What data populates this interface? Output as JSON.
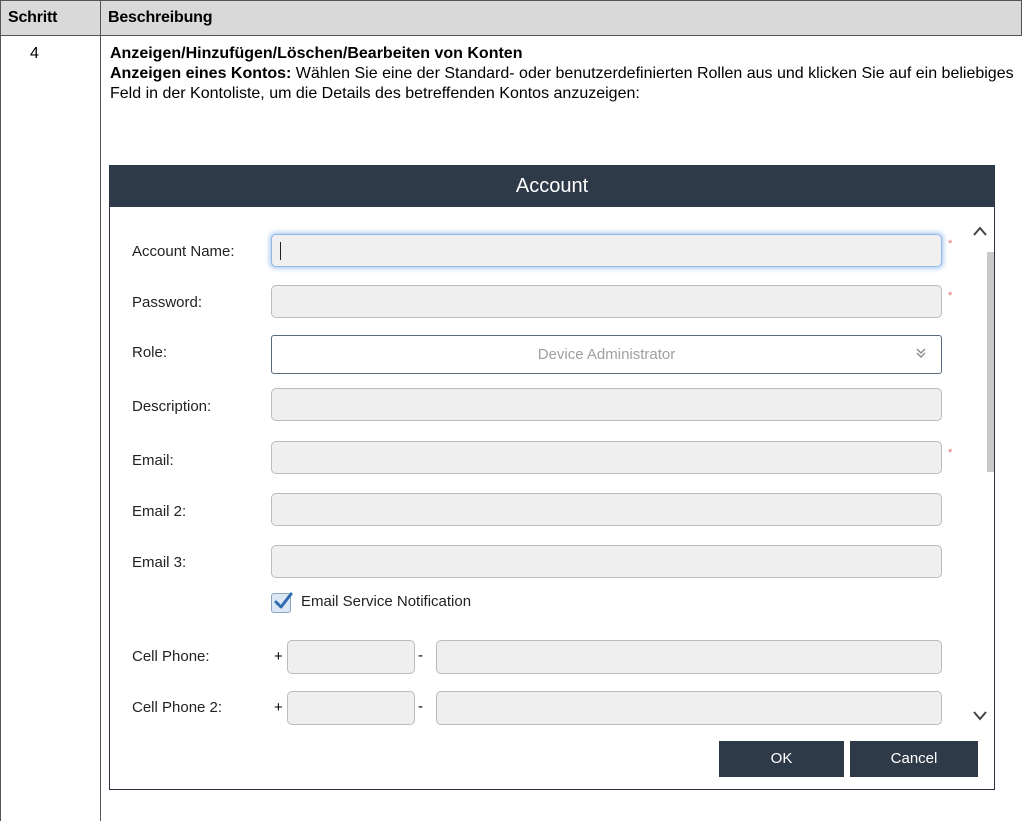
{
  "table": {
    "col_step": "Schritt",
    "col_desc": "Beschreibung",
    "step_number": "4",
    "step_title": "Anzeigen/Hinzufügen/Löschen/Bearbeiten von Konten",
    "lead": "Anzeigen eines Kontos:",
    "body": " Wählen Sie eine der Standard- oder benutzerdefinierten Rollen aus und klicken Sie auf ein beliebiges Feld in der Kontoliste, um die Details des betreffenden Kontos anzuzeigen:"
  },
  "dialog": {
    "title": "Account",
    "labels": {
      "account_name": "Account Name:",
      "password": "Password:",
      "role": "Role:",
      "description": "Description:",
      "email": "Email:",
      "email2": "Email 2:",
      "email3": "Email 3:",
      "cell_phone": "Cell Phone:",
      "cell_phone2": "Cell Phone 2:"
    },
    "role_value": "Device Administrator",
    "email_service_notification": "Email Service Notification",
    "email_service_checked": true,
    "required_marker": "*",
    "plus": "+",
    "dash": "-",
    "ok_label": "OK",
    "cancel_label": "Cancel",
    "icons": {
      "select_arrow": "double-chevron-down-icon",
      "scroll_up": "chevron-up-icon",
      "scroll_down": "chevron-down-icon",
      "checkbox": "checkmark-icon"
    },
    "colors": {
      "title_bar": "#2f3a49",
      "button": "#2f3a49",
      "required": "#e57373"
    }
  }
}
